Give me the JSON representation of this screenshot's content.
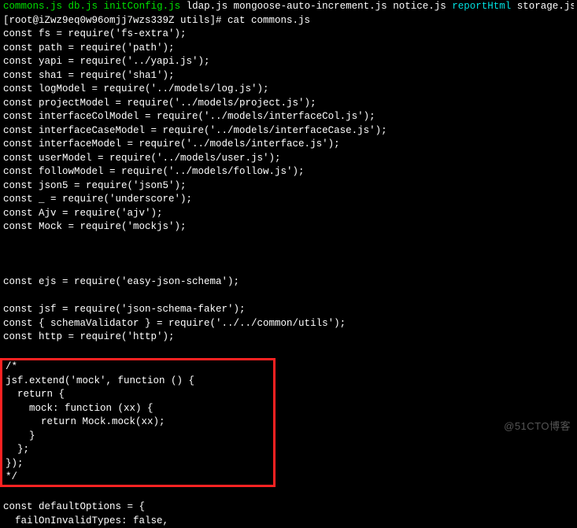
{
  "top": {
    "file1": "commons.js",
    "file2": "db.js",
    "file3": "initConfig.js",
    "file4": "ldap.js",
    "file5": "mongoose-auto-increment.js",
    "file6": "notice.js",
    "file7": "reportHtml",
    "file8": "storage.js"
  },
  "prompt": "[root@iZwz9eq0w96omjj7wzs339Z utils]# cat commons.js",
  "code": {
    "l01": "const fs = require('fs-extra');",
    "l02": "const path = require('path');",
    "l03": "const yapi = require('../yapi.js');",
    "l04": "const sha1 = require('sha1');",
    "l05": "const logModel = require('../models/log.js');",
    "l06": "const projectModel = require('../models/project.js');",
    "l07": "const interfaceColModel = require('../models/interfaceCol.js');",
    "l08": "const interfaceCaseModel = require('../models/interfaceCase.js');",
    "l09": "const interfaceModel = require('../models/interface.js');",
    "l10": "const userModel = require('../models/user.js');",
    "l11": "const followModel = require('../models/follow.js');",
    "l12": "const json5 = require('json5');",
    "l13": "const _ = require('underscore');",
    "l14": "const Ajv = require('ajv');",
    "l15": "const Mock = require('mockjs');",
    "l16": "const ejs = require('easy-json-schema');",
    "l17": "const jsf = require('json-schema-faker');",
    "l18": "const { schemaValidator } = require('../../common/utils');",
    "l19": "const http = require('http');"
  },
  "highlight": {
    "h1": "/*",
    "h2": "jsf.extend('mock', function () {",
    "h3": "  return {",
    "h4": "    mock: function (xx) {",
    "h5": "      return Mock.mock(xx);",
    "h6": "    }",
    "h7": "  };",
    "h8": "});",
    "h9": "*/"
  },
  "tail": {
    "t1": "const defaultOptions = {",
    "t2": "  failOnInvalidTypes: false,"
  },
  "watermark": "@51CTO博客"
}
